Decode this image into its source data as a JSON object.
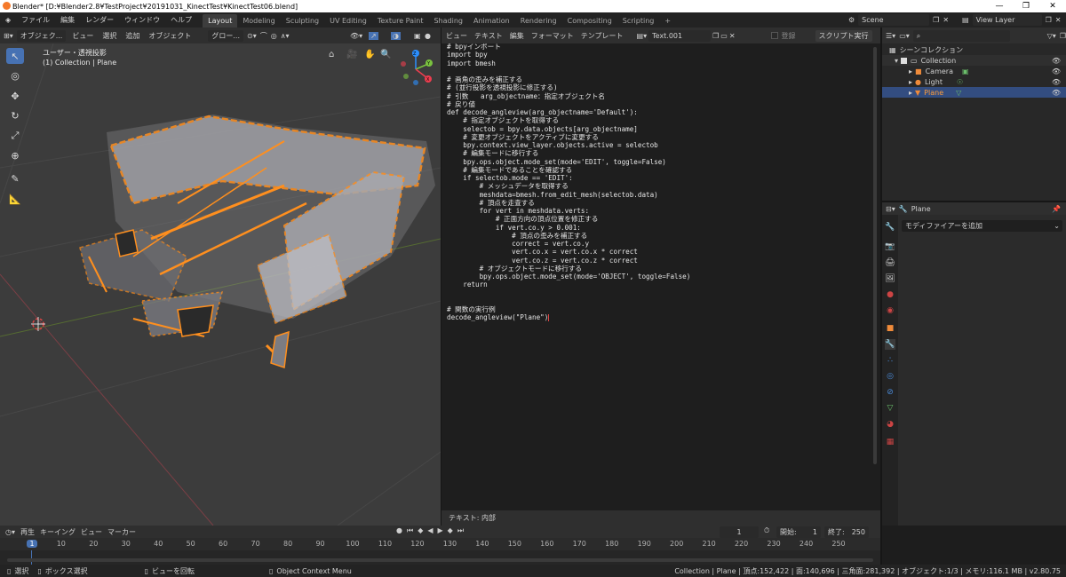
{
  "window": {
    "title": "Blender* [D:¥Blender2.8¥TestProject¥20191031_KinectTest¥KinectTest06.blend]",
    "minimize": "—",
    "maximize": "❐",
    "close": "✕"
  },
  "menu": {
    "items": [
      "ファイル",
      "編集",
      "レンダー",
      "ウィンドウ",
      "ヘルプ"
    ],
    "workspaces": [
      "Layout",
      "Modeling",
      "Sculpting",
      "UV Editing",
      "Texture Paint",
      "Shading",
      "Animation",
      "Rendering",
      "Compositing",
      "Scripting"
    ],
    "add_workspace": "+",
    "scene_label": "Scene",
    "view_layer_label": "View Layer"
  },
  "viewport": {
    "mode": "オブジェク...",
    "menus": [
      "ビュー",
      "選択",
      "追加",
      "オブジェクト"
    ],
    "transform_orientation": "グロー...",
    "view_name": "ユーザー・透視投影",
    "collection_path": "(1) Collection | Plane",
    "gizmo_axes": [
      "Z",
      "Y",
      "X"
    ],
    "colors": {
      "x": "#ee3d4f",
      "y": "#7ac23f",
      "z": "#2c8fff",
      "selection": "#ff8f1e"
    }
  },
  "text_editor": {
    "menus": [
      "ビュー",
      "テキスト",
      "編集",
      "フォーマット",
      "テンプレート"
    ],
    "file_name": "Text.001",
    "register_label": "登録",
    "run_script_label": "スクリプト実行",
    "footer": "テキスト: 内部",
    "code_lines": [
      "# bpyインポート",
      "import bpy",
      "import bmesh",
      "",
      "# 画角の歪みを補正する",
      "# (並行投影を透視投影に修正する)",
      "# 引数   arg_objectname：指定オブジェクト名",
      "# 戻り値",
      "def decode_angleview(arg_objectname='Default'):",
      "    # 指定オブジェクトを取得する",
      "    selectob = bpy.data.objects[arg_objectname]",
      "    # 変更オブジェクトをアクティブに変更する",
      "    bpy.context.view_layer.objects.active = selectob",
      "    # 編集モードに移行する",
      "    bpy.ops.object.mode_set(mode='EDIT', toggle=False)",
      "    # 編集モードであることを確認する",
      "    if selectob.mode == 'EDIT':",
      "        # メッシュデータを取得する",
      "        meshdata=bmesh.from_edit_mesh(selectob.data)",
      "        # 頂点を走査する",
      "        for vert in meshdata.verts:",
      "            # 正面方向の頂点位置を修正する",
      "            if vert.co.y > 0.001:",
      "                # 頂点の歪みを補正する",
      "                correct = vert.co.y",
      "                vert.co.x = vert.co.x * correct",
      "                vert.co.z = vert.co.z * correct",
      "        # オブジェクトモードに移行する",
      "        bpy.ops.object.mode_set(mode='OBJECT', toggle=False)",
      "    return",
      "",
      "",
      "# 関数の実行例",
      "decode_angleview(\"Plane\")"
    ]
  },
  "outliner": {
    "root": "シーンコレクション",
    "items": [
      {
        "label": "Collection",
        "icon": "collection-icon"
      },
      {
        "label": "Camera",
        "icon": "camera-icon"
      },
      {
        "label": "Light",
        "icon": "light-icon"
      },
      {
        "label": "Plane",
        "icon": "mesh-icon"
      }
    ]
  },
  "properties": {
    "object_name": "Plane",
    "add_modifier": "モディファイアーを追加",
    "tabs": [
      "tool-tab-icon",
      "render-tab-icon",
      "output-tab-icon",
      "view-layer-tab-icon",
      "scene-tab-icon",
      "world-tab-icon",
      "object-tab-icon",
      "modifier-tab-icon",
      "particles-tab-icon",
      "physics-tab-icon",
      "constraints-tab-icon",
      "data-tab-icon",
      "material-tab-icon",
      "texture-tab-icon"
    ]
  },
  "timeline": {
    "menus": [
      "再生",
      "キーイング",
      "ビュー",
      "マーカー"
    ],
    "current_frame": "1",
    "start_label": "開始:",
    "start": "1",
    "end_label": "終了:",
    "end": "250",
    "ticks": [
      "1",
      "10",
      "20",
      "30",
      "40",
      "50",
      "60",
      "70",
      "80",
      "90",
      "100",
      "110",
      "120",
      "130",
      "140",
      "150",
      "160",
      "170",
      "180",
      "190",
      "200",
      "210",
      "220",
      "230",
      "240",
      "250"
    ]
  },
  "status": {
    "select": "選択",
    "box_select": "ボックス選択",
    "rotate_view": "ビューを回転",
    "context_menu": "Object Context Menu",
    "stats": "Collection | Plane | 頂点:152,422 | 面:140,696 | 三角面:281,392 | オブジェクト:1/3 | メモリ:116.1 MB | v2.80.75"
  }
}
